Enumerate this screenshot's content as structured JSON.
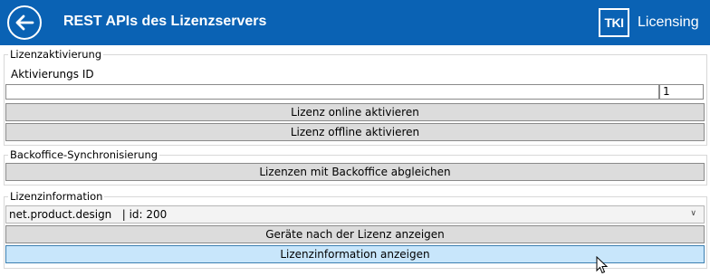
{
  "header": {
    "title": "REST APIs des Lizenzservers",
    "brand_mark": "TKI",
    "brand_text": "Licensing",
    "background": "#0a62b4"
  },
  "activation": {
    "group_label": "Lizenzaktivierung",
    "id_label": "Aktivierungs ID",
    "id_value": "",
    "count_value": "1",
    "online_button": "Lizenz online aktivieren",
    "offline_button": "Lizenz offline aktivieren"
  },
  "backoffice": {
    "group_label": "Backoffice-Synchronisierung",
    "sync_button": "Lizenzen mit Backoffice abgleichen"
  },
  "license_info": {
    "group_label": "Lizenzinformation",
    "selected": "net.product.design   | id: 200",
    "devices_button": "Geräte nach der Lizenz anzeigen",
    "info_button": "Lizenzinformation anzeigen",
    "hover_color": "#c8e6fb"
  },
  "icons": {
    "back": "arrow-left-icon",
    "dropdown": "chevron-down-icon",
    "cursor": "mouse-pointer-icon"
  }
}
